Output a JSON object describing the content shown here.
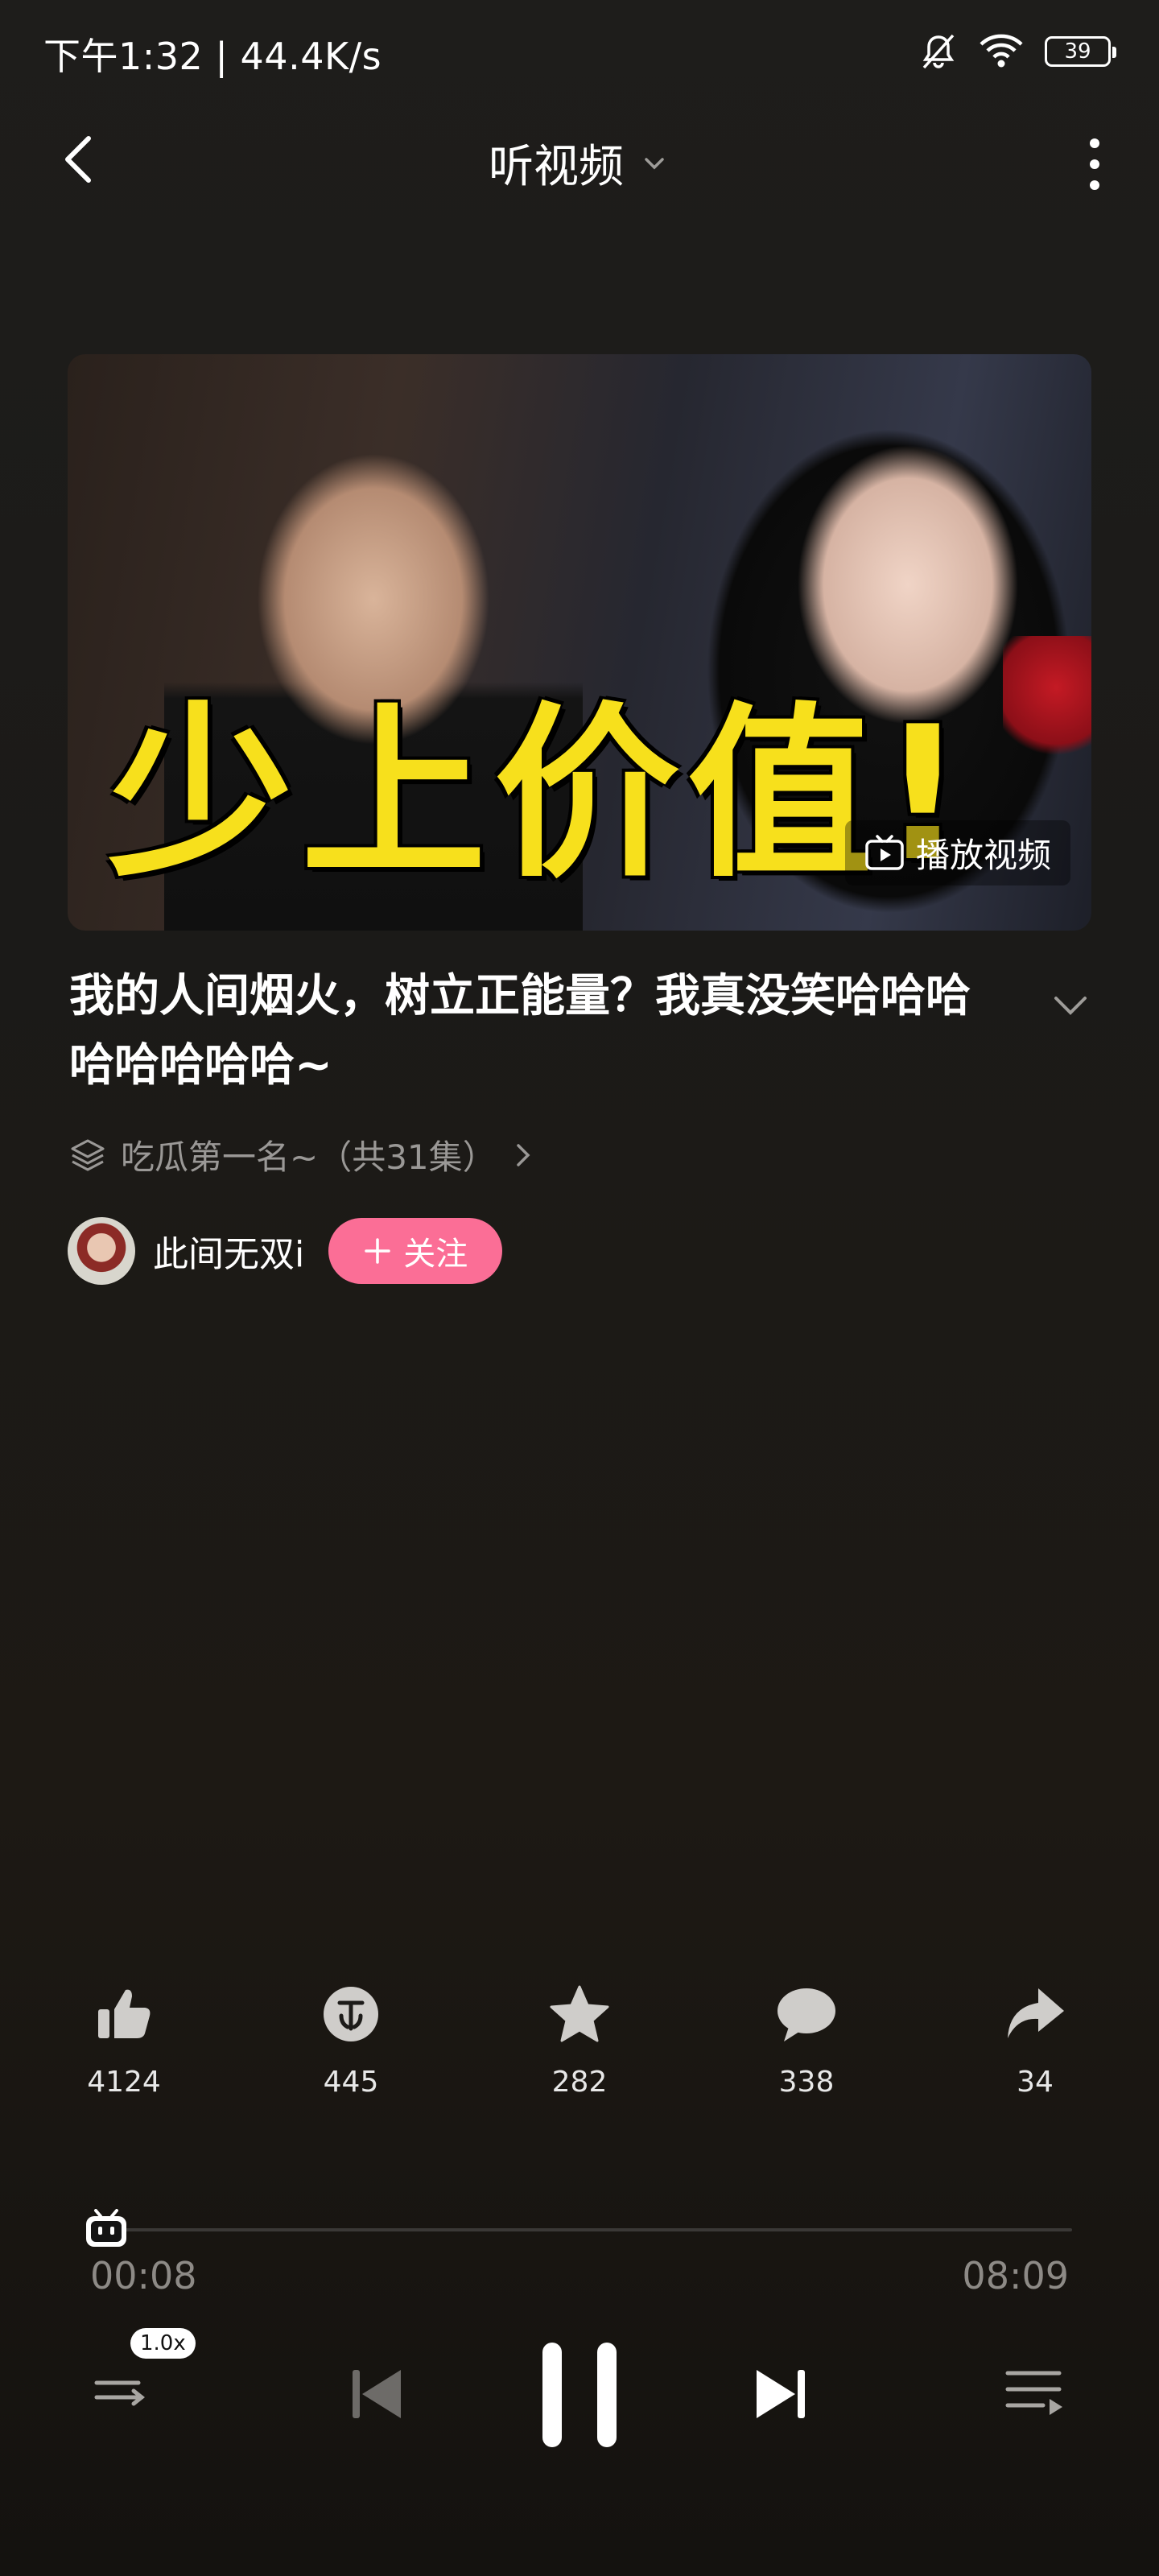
{
  "status_bar": {
    "time_speed": "下午1:32 | 44.4K/s",
    "battery": "39"
  },
  "header": {
    "title": "听视频"
  },
  "cover": {
    "caption": "少上价值!",
    "play_video_label": "播放视频"
  },
  "video": {
    "title": "我的人间烟火，树立正能量？我真没笑哈哈哈哈哈哈哈哈~",
    "collection": "吃瓜第一名~（共31集）"
  },
  "uploader": {
    "name": "此间无双i",
    "follow_label": "关注"
  },
  "actions": {
    "like": "4124",
    "coin": "445",
    "favorite": "282",
    "comment": "338",
    "share": "34"
  },
  "player": {
    "current_time": "00:08",
    "total_time": "08:09",
    "progress_fraction": 0.016,
    "speed": "1.0x"
  },
  "colors": {
    "accent": "#fb6e96",
    "caption_yellow": "#f7e01c"
  }
}
